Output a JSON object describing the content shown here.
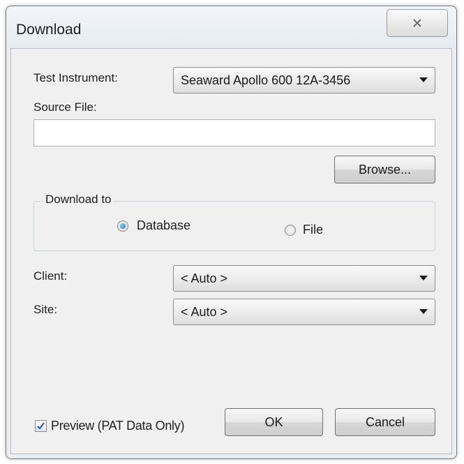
{
  "window": {
    "title": "Download"
  },
  "form": {
    "test_instrument_label": "Test Instrument:",
    "test_instrument_value": "Seaward Apollo 600 12A-3456",
    "source_file_label": "Source File:",
    "source_file_value": "",
    "browse_label": "Browse...",
    "download_to": {
      "title": "Download to",
      "options": [
        {
          "label": "Database",
          "checked": true
        },
        {
          "label": "File",
          "checked": false
        }
      ]
    },
    "client_label": "Client:",
    "client_value": "< Auto >",
    "site_label": "Site:",
    "site_value": "< Auto >"
  },
  "footer": {
    "preview_label": "Preview (PAT Data Only)",
    "preview_checked": true,
    "ok_label": "OK",
    "cancel_label": "Cancel"
  },
  "icons": {
    "close": "close-icon",
    "dropdown": "chevron-down-icon",
    "check": "checkmark-icon"
  },
  "colors": {
    "accent": "#1f6fb5",
    "check": "#2b56c9"
  }
}
